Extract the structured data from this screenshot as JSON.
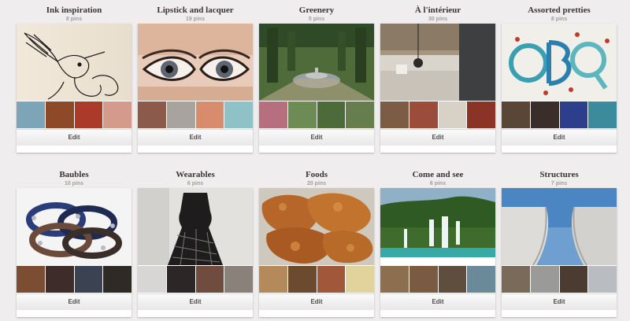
{
  "boards": [
    {
      "title": "Ink inspiration",
      "count": "8 pins",
      "edit_label": "Edit",
      "cover": "ink-hummingbird",
      "thumbs": [
        "#7ea4b8",
        "#8e4a28",
        "#ab3a2a",
        "#d49a8c"
      ]
    },
    {
      "title": "Lipstick and lacquer",
      "count": "19 pins",
      "edit_label": "Edit",
      "cover": "eye-makeup",
      "thumbs": [
        "#8b5a4a",
        "#a9a3a0",
        "#d98b6e",
        "#8fc1c6"
      ]
    },
    {
      "title": "Greenery",
      "count": "5 pins",
      "edit_label": "Edit",
      "cover": "garden-fountain",
      "thumbs": [
        "#b76e7f",
        "#6d8b55",
        "#4d6a3b",
        "#667d4e"
      ]
    },
    {
      "title": "À l'intérieur",
      "count": "30 pins",
      "edit_label": "Edit",
      "cover": "interior-room",
      "thumbs": [
        "#7c5c44",
        "#9b4c3a",
        "#d7d1c6",
        "#8b3327"
      ]
    },
    {
      "title": "Assorted pretties",
      "count": "8 pins",
      "edit_label": "Edit",
      "cover": "quilled-letters",
      "thumbs": [
        "#5a4636",
        "#3a2d2a",
        "#2d3f8c",
        "#3b8b9c"
      ]
    },
    {
      "title": "Baubles",
      "count": "10 pins",
      "edit_label": "Edit",
      "cover": "bead-bracelets",
      "thumbs": [
        "#7b4e33",
        "#3d2c2a",
        "#3b4252",
        "#2f2a26"
      ]
    },
    {
      "title": "Wearables",
      "count": "6 pins",
      "edit_label": "Edit",
      "cover": "lace-dress",
      "thumbs": [
        "#d8d6d4",
        "#2c2626",
        "#6f4c3e",
        "#8b817b"
      ]
    },
    {
      "title": "Foods",
      "count": "20 pins",
      "edit_label": "Edit",
      "cover": "fried-chicken",
      "thumbs": [
        "#b48a5c",
        "#6b4a30",
        "#a1573a",
        "#e2d29c"
      ]
    },
    {
      "title": "Come and see",
      "count": "6 pins",
      "edit_label": "Edit",
      "cover": "waterfalls",
      "thumbs": [
        "#8b6f4f",
        "#7b5a42",
        "#5f4e3e",
        "#6a8a9a"
      ]
    },
    {
      "title": "Structures",
      "count": "7 pins",
      "edit_label": "Edit",
      "cover": "modern-building",
      "thumbs": [
        "#7a6a5a",
        "#9a9a98",
        "#4b3b30",
        "#b9bcc0"
      ]
    }
  ]
}
